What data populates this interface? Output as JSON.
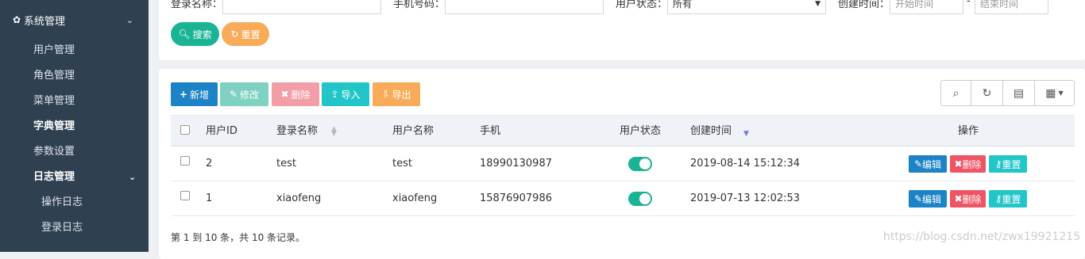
{
  "sidebar": {
    "group_label": "系统管理",
    "items": [
      "用户管理",
      "角色管理",
      "菜单管理",
      "字典管理",
      "参数设置"
    ],
    "log_label": "日志管理",
    "log_items": [
      "操作日志",
      "登录日志"
    ]
  },
  "search": {
    "login_label": "登录名称：",
    "phone_label": "手机号码：",
    "status_label": "用户状态：",
    "status_value": "所有",
    "created_label": "创建时间：",
    "start_placeholder": "开始时间",
    "dash": "-",
    "end_placeholder": "结束时间",
    "search_button": "搜索",
    "reset_button": "重置"
  },
  "toolbar": {
    "add": "新增",
    "edit": "修改",
    "delete": "删除",
    "import": "导入",
    "export": "导出"
  },
  "table": {
    "headers": [
      "用户ID",
      "登录名称",
      "用户名称",
      "手机",
      "用户状态",
      "创建时间",
      "操作"
    ],
    "rows": [
      {
        "id": "2",
        "login": "test",
        "name": "test",
        "phone": "18990130987",
        "created": "2019-08-14 15:12:34"
      },
      {
        "id": "1",
        "login": "xiaofeng",
        "name": "xiaofeng",
        "phone": "15876907986",
        "created": "2019-07-13 12:02:53"
      }
    ],
    "actions": {
      "edit": "编辑",
      "delete": "删除",
      "reset": "重置"
    }
  },
  "footer": "第 1 到 10 条，共 10 条记录。",
  "watermark": "https://blog.csdn.net/zwx19921215",
  "colors": {
    "sidebar": "#2f4050",
    "primary": "#1c84c6",
    "teal": "#1ab394",
    "warning": "#f8ac59",
    "danger": "#ed5565",
    "info": "#23c6c8"
  }
}
